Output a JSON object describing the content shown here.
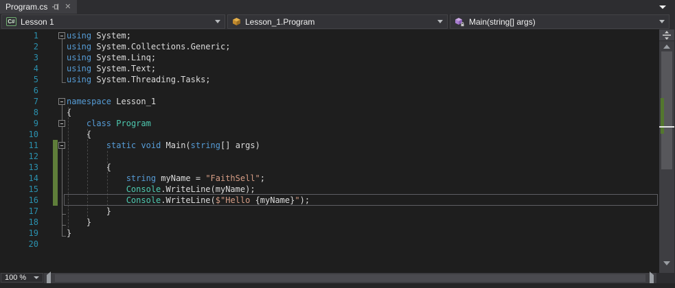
{
  "tab": {
    "title": "Program.cs"
  },
  "nav": {
    "csharp_badge": "C#",
    "project": "Lesson 1",
    "type": "Lesson_1.Program",
    "member": "Main(string[] args)"
  },
  "statusbar": {
    "zoom_level": "100 %"
  },
  "colors": {
    "frame_bg": "#2d2d30",
    "tab_active_bg": "#3e3e42",
    "editor_bg": "#1e1e1e",
    "combo_bg": "#333337",
    "combo_border": "#434346",
    "ui_text": "#f1f1f1",
    "icon_gray": "#a6a6a6",
    "line_number": "#2b91af",
    "keyword": "#569cd6",
    "type_name": "#4ec9b0",
    "string_literal": "#d69d85",
    "plain_text": "#dcdcdc",
    "indent_guide": "#474747",
    "outline_line": "#6f6f6f",
    "fold_box_border": "#848484",
    "change_bar_green": "#5f7e3a",
    "current_line_border": "#5f5f64",
    "scroll_track": "#3e3e42",
    "scroll_thumb": "#57575b",
    "scroll_arrow": "#9a9ea3",
    "scroll_change_green": "#53772e",
    "scroll_caret_white": "#e8e8e8",
    "bottom_strip": "#252526",
    "csharp_icon_green": "#6fae6f",
    "class_icon_orange": "#d8a33c",
    "method_icon_purple": "#b180d7"
  },
  "code": {
    "current_line": 16,
    "change_bar": {
      "from_line": 11,
      "to_line": 16
    },
    "fold_boxes": [
      1,
      7,
      9,
      11
    ],
    "fold_lines": [
      {
        "from_line": 1,
        "to_line": 5
      },
      {
        "from_line": 7,
        "to_line": 19
      }
    ],
    "fold_ticks": [
      5,
      17,
      18,
      19
    ],
    "indent_guides": [
      {
        "col": 0,
        "from_line": 8,
        "to_line": 18
      },
      {
        "col": 4,
        "from_line": 10,
        "to_line": 17
      },
      {
        "col": 8,
        "from_line": 12,
        "to_line": 16
      }
    ],
    "lines": [
      {
        "num": 1,
        "segments": [
          [
            "kw",
            "using"
          ],
          [
            "pl",
            " System;"
          ]
        ]
      },
      {
        "num": 2,
        "segments": [
          [
            "kw",
            "using"
          ],
          [
            "pl",
            " System.Collections.Generic;"
          ]
        ]
      },
      {
        "num": 3,
        "segments": [
          [
            "kw",
            "using"
          ],
          [
            "pl",
            " System.Linq;"
          ]
        ]
      },
      {
        "num": 4,
        "segments": [
          [
            "kw",
            "using"
          ],
          [
            "pl",
            " System.Text;"
          ]
        ]
      },
      {
        "num": 5,
        "segments": [
          [
            "kw",
            "using"
          ],
          [
            "pl",
            " System.Threading.Tasks;"
          ]
        ]
      },
      {
        "num": 6,
        "segments": []
      },
      {
        "num": 7,
        "segments": [
          [
            "kw",
            "namespace"
          ],
          [
            "pl",
            " Lesson_1"
          ]
        ]
      },
      {
        "num": 8,
        "segments": [
          [
            "pl",
            "{"
          ]
        ]
      },
      {
        "num": 9,
        "segments": [
          [
            "pl",
            "    "
          ],
          [
            "kw",
            "class"
          ],
          [
            "pl",
            " "
          ],
          [
            "ty",
            "Program"
          ]
        ]
      },
      {
        "num": 10,
        "segments": [
          [
            "pl",
            "    {"
          ]
        ]
      },
      {
        "num": 11,
        "segments": [
          [
            "pl",
            "        "
          ],
          [
            "kw",
            "static"
          ],
          [
            "pl",
            " "
          ],
          [
            "kw",
            "void"
          ],
          [
            "pl",
            " Main("
          ],
          [
            "kw",
            "string"
          ],
          [
            "pl",
            "[] args)"
          ]
        ]
      },
      {
        "num": 12,
        "segments": []
      },
      {
        "num": 13,
        "segments": [
          [
            "pl",
            "        {"
          ]
        ]
      },
      {
        "num": 14,
        "segments": [
          [
            "pl",
            "            "
          ],
          [
            "kw",
            "string"
          ],
          [
            "pl",
            " myName = "
          ],
          [
            "st",
            "\"FaithSell\""
          ],
          [
            "pl",
            ";"
          ]
        ]
      },
      {
        "num": 15,
        "segments": [
          [
            "pl",
            "            "
          ],
          [
            "ty",
            "Console"
          ],
          [
            "pl",
            ".WriteLine(myName);"
          ]
        ]
      },
      {
        "num": 16,
        "segments": [
          [
            "pl",
            "            "
          ],
          [
            "ty",
            "Console"
          ],
          [
            "pl",
            ".WriteLine("
          ],
          [
            "st",
            "$\"Hello "
          ],
          [
            "pl",
            "{myName}"
          ],
          [
            "st",
            "\""
          ],
          [
            "pl",
            ");"
          ]
        ]
      },
      {
        "num": 17,
        "segments": [
          [
            "pl",
            "        }"
          ]
        ]
      },
      {
        "num": 18,
        "segments": [
          [
            "pl",
            "    }"
          ]
        ]
      },
      {
        "num": 19,
        "segments": [
          [
            "pl",
            "}"
          ]
        ]
      },
      {
        "num": 20,
        "segments": []
      }
    ]
  }
}
